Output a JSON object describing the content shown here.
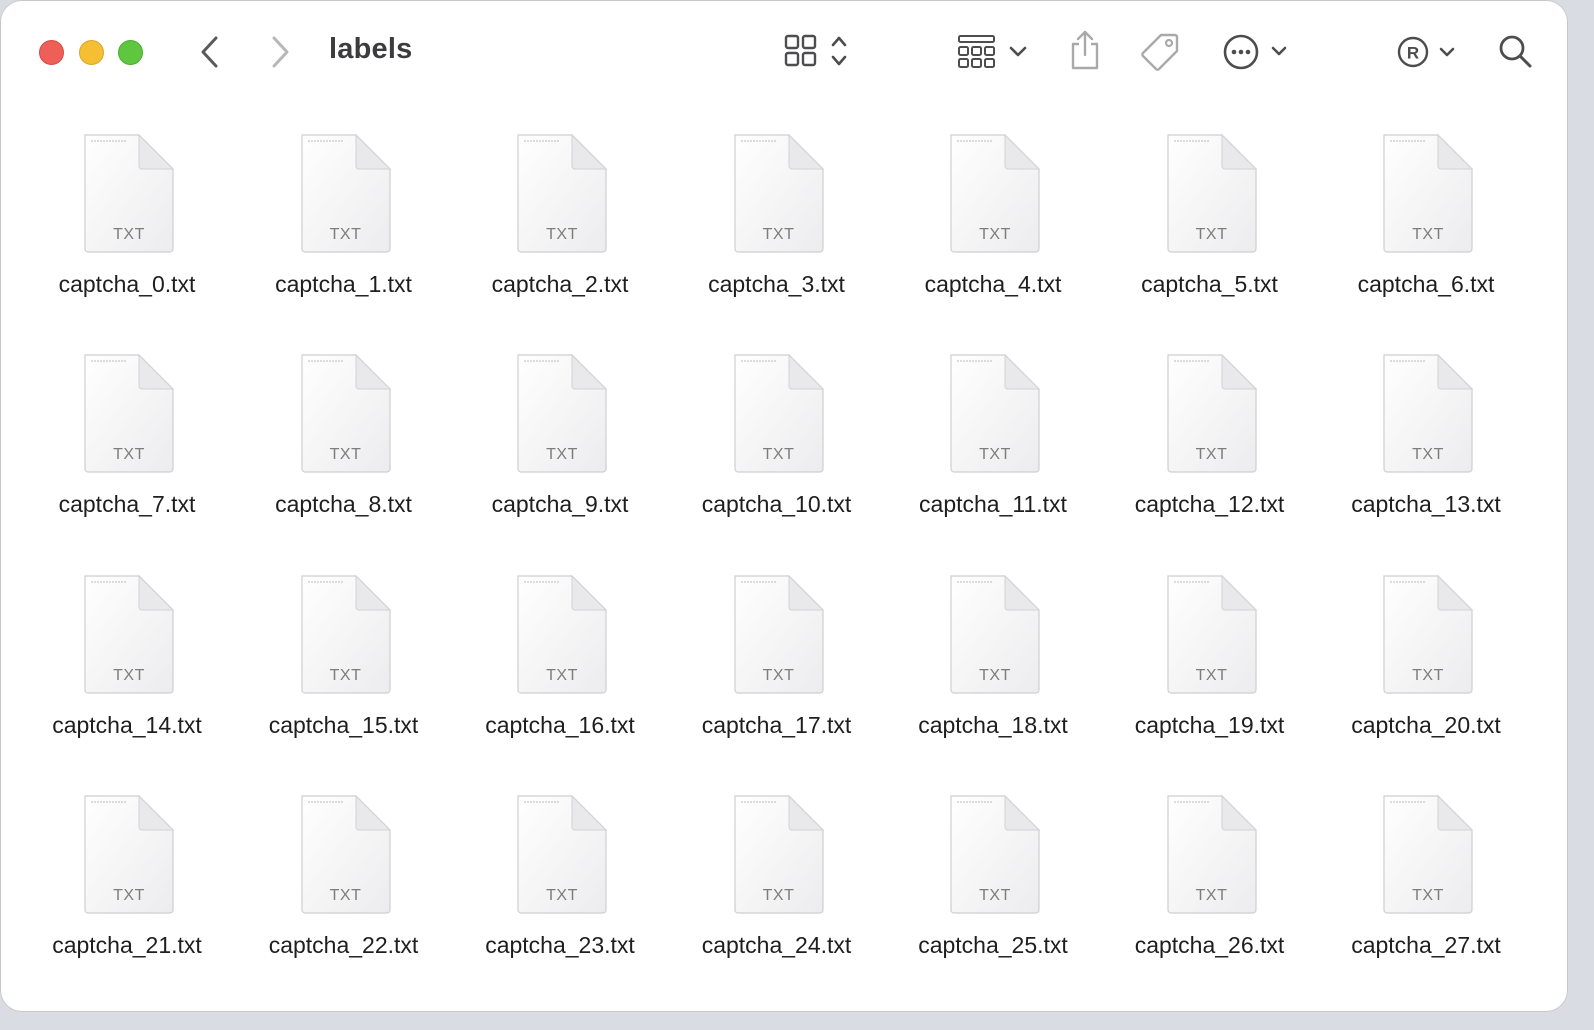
{
  "window": {
    "title": "labels"
  },
  "toolbar": {
    "back_icon": "chevron-left-icon",
    "forward_icon": "chevron-right-icon",
    "view_icon": "grid-view-icon",
    "group_icon": "group-icon",
    "share_icon": "share-icon",
    "tag_icon": "tag-icon",
    "more_icon": "ellipsis-circle-icon",
    "account_icon": "registered-icon",
    "search_icon": "search-icon"
  },
  "colors": {
    "close": "#ee5f57",
    "minimize": "#f5be33",
    "zoom": "#5ec63f"
  },
  "files": [
    {
      "name": "captcha_0.txt",
      "type": "TXT"
    },
    {
      "name": "captcha_1.txt",
      "type": "TXT"
    },
    {
      "name": "captcha_2.txt",
      "type": "TXT"
    },
    {
      "name": "captcha_3.txt",
      "type": "TXT"
    },
    {
      "name": "captcha_4.txt",
      "type": "TXT"
    },
    {
      "name": "captcha_5.txt",
      "type": "TXT"
    },
    {
      "name": "captcha_6.txt",
      "type": "TXT"
    },
    {
      "name": "captcha_7.txt",
      "type": "TXT"
    },
    {
      "name": "captcha_8.txt",
      "type": "TXT"
    },
    {
      "name": "captcha_9.txt",
      "type": "TXT"
    },
    {
      "name": "captcha_10.txt",
      "type": "TXT"
    },
    {
      "name": "captcha_11.txt",
      "type": "TXT"
    },
    {
      "name": "captcha_12.txt",
      "type": "TXT"
    },
    {
      "name": "captcha_13.txt",
      "type": "TXT"
    },
    {
      "name": "captcha_14.txt",
      "type": "TXT"
    },
    {
      "name": "captcha_15.txt",
      "type": "TXT"
    },
    {
      "name": "captcha_16.txt",
      "type": "TXT"
    },
    {
      "name": "captcha_17.txt",
      "type": "TXT"
    },
    {
      "name": "captcha_18.txt",
      "type": "TXT"
    },
    {
      "name": "captcha_19.txt",
      "type": "TXT"
    },
    {
      "name": "captcha_20.txt",
      "type": "TXT"
    },
    {
      "name": "captcha_21.txt",
      "type": "TXT"
    },
    {
      "name": "captcha_22.txt",
      "type": "TXT"
    },
    {
      "name": "captcha_23.txt",
      "type": "TXT"
    },
    {
      "name": "captcha_24.txt",
      "type": "TXT"
    },
    {
      "name": "captcha_25.txt",
      "type": "TXT"
    },
    {
      "name": "captcha_26.txt",
      "type": "TXT"
    },
    {
      "name": "captcha_27.txt",
      "type": "TXT"
    }
  ]
}
